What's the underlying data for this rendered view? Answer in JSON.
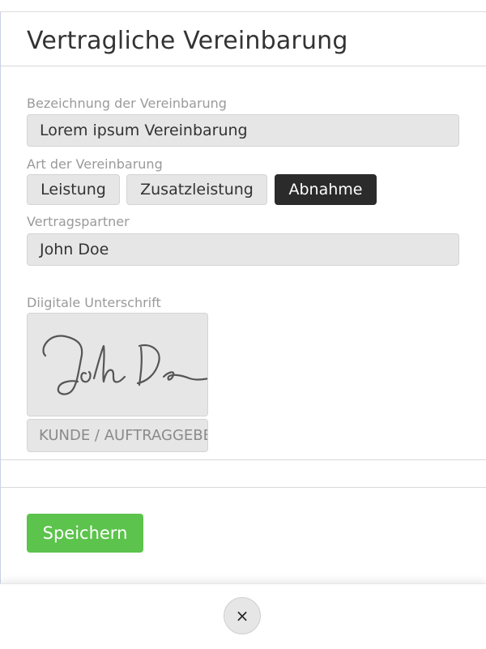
{
  "dialog": {
    "title": "Vertragliche Vereinbarung"
  },
  "form": {
    "name_label": "Bezeichnung der Vereinbarung",
    "name_value": "Lorem ipsum Vereinbarung",
    "type_label": "Art der Vereinbarung",
    "type_options": [
      "Leistung",
      "Zusatzleistung",
      "Abnahme"
    ],
    "type_selected": "Abnahme",
    "partner_label": "Vertragspartner",
    "partner_value": "John Doe",
    "signature_label": "Diigitale Unterschrift",
    "signature_role": "KUNDE / AUFTRAGGEBER"
  },
  "actions": {
    "save_label": "Speichern",
    "close_icon": "×"
  },
  "colors": {
    "accent_green": "#5cc34c",
    "selected_segment": "#2b2b2b",
    "field_bg": "#e6e6e6"
  }
}
